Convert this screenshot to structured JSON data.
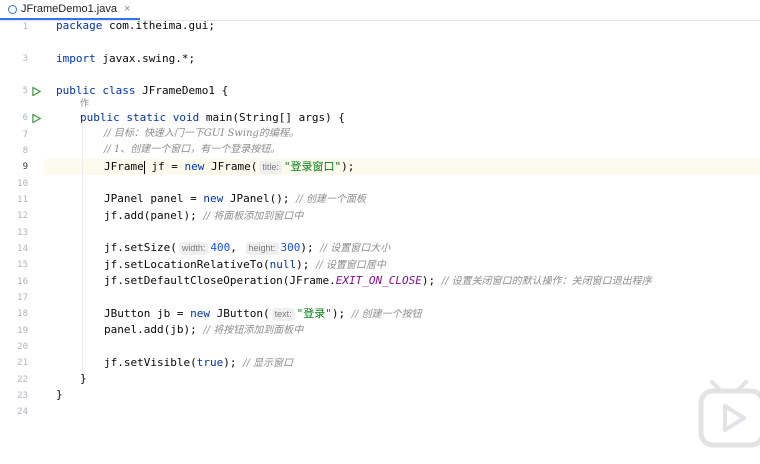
{
  "tab": {
    "filename": "JFrameDemo1.java",
    "close": "×",
    "icon": "java-class-icon"
  },
  "gutter": {
    "lines": [
      "1",
      "3",
      "5",
      "6",
      "7",
      "8",
      "9",
      "10",
      "11",
      "12",
      "13",
      "14",
      "15",
      "16",
      "17",
      "18",
      "19",
      "20",
      "21",
      "22",
      "23",
      "24"
    ],
    "current_line": "9"
  },
  "lens": "作",
  "code": {
    "l1_pkg": "package",
    "l1_name": " com.itheima.gui;",
    "l3_import": "import",
    "l3_name": " javax.swing.*;",
    "l5_public": "public",
    "l5_class": " class",
    "l5_name": " JFrameDemo1 {",
    "l6_public": "public",
    "l6_static": " static",
    "l6_void": " void",
    "l6_rest": " main(String[] args) {",
    "l7_comment": "// 目标：快速入门一下GUI Swing的编程。",
    "l8_comment": "// 1、创建一个窗口，有一个登录按钮。",
    "l9_a": "JFrame",
    "l9_b": " jf = ",
    "l9_new": "new",
    "l9_c": " JFrame(",
    "l9_hint": "title:",
    "l9_str": "\"登录窗口\"",
    "l9_end": ");",
    "l11_a": "JPanel panel = ",
    "l11_new": "new",
    "l11_b": " JPanel(); ",
    "l11_comment": "// 创建一个面板",
    "l12_a": "jf.add(panel); ",
    "l12_comment": "// 将面板添加到窗口中",
    "l14_a": "jf.setSize(",
    "l14_hint1": "width:",
    "l14_n1": "400",
    "l14_sep": ", ",
    "l14_hint2": "height:",
    "l14_n2": "300",
    "l14_end": "); ",
    "l14_comment": "// 设置窗口大小",
    "l15_a": "jf.setLocationRelativeTo(",
    "l15_null": "null",
    "l15_end": "); ",
    "l15_comment": "// 设置窗口居中",
    "l16_a": "jf.setDefaultCloseOperation(JFrame.",
    "l16_const": "EXIT_ON_CLOSE",
    "l16_end": "); ",
    "l16_comment": "// 设置关闭窗口的默认操作：关闭窗口退出程序",
    "l18_a": "JButton jb = ",
    "l18_new": "new",
    "l18_b": " JButton(",
    "l18_hint": "text:",
    "l18_str": "\"登录\"",
    "l18_end": "); ",
    "l18_comment": "// 创建一个按钮",
    "l19_a": "panel.add(jb); ",
    "l19_comment": "// 将按钮添加到面板中",
    "l21_a": "jf.setVisible(",
    "l21_true": "true",
    "l21_end": "); ",
    "l21_comment": "// 显示窗口",
    "l22": "}",
    "l23": "}"
  },
  "colors": {
    "keyword": "#0033b3",
    "string": "#067d17",
    "number": "#1750eb",
    "comment": "#8c8c8c",
    "accent": "#3574f0",
    "current_line": "#fcfaed"
  },
  "overlay": {
    "icon": "bilibili-play-icon"
  }
}
